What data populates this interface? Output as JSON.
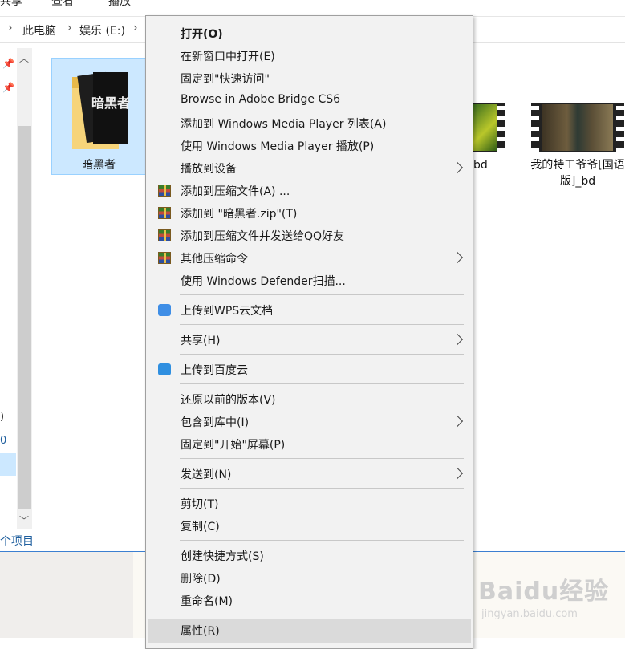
{
  "ribbon": {
    "tabs": [
      "共享",
      "查看",
      "播放"
    ]
  },
  "address_bar": {
    "crumbs": [
      "此电脑",
      "娱乐 (E:)"
    ]
  },
  "nav_pane": {
    "partial_labels": [
      ")",
      "0"
    ]
  },
  "status_bar": {
    "text": "个项目"
  },
  "files": [
    {
      "name": "暗黑者",
      "folder_art_text": "暗黑者",
      "selected": true
    },
    {
      "name": "bd",
      "partial": true
    },
    {
      "name": "我的特工爷爷[国语版]_bd"
    }
  ],
  "context_menu": {
    "items": [
      {
        "label": "打开(O)",
        "bold": true
      },
      {
        "label": "在新窗口中打开(E)"
      },
      {
        "label": "固定到\"快速访问\""
      },
      {
        "label": "Browse in Adobe Bridge CS6"
      },
      {
        "label": "添加到 Windows Media Player 列表(A)"
      },
      {
        "label": "使用 Windows Media Player 播放(P)"
      },
      {
        "label": "播放到设备",
        "submenu": true
      },
      {
        "label": "添加到压缩文件(A) ...",
        "icon": "winrar-icon"
      },
      {
        "label": "添加到 \"暗黑者.zip\"(T)",
        "icon": "winrar-icon"
      },
      {
        "label": "添加到压缩文件并发送给QQ好友",
        "icon": "winrar-icon"
      },
      {
        "label": "其他压缩命令",
        "icon": "winrar-icon",
        "submenu": true
      },
      {
        "label": "使用 Windows Defender扫描..."
      },
      {
        "label": "上传到WPS云文档",
        "icon": "wps-cloud-icon"
      },
      {
        "label": "共享(H)",
        "submenu": true
      },
      {
        "label": "上传到百度云",
        "icon": "baidu-cloud-icon"
      },
      {
        "label": "还原以前的版本(V)"
      },
      {
        "label": "包含到库中(I)",
        "submenu": true
      },
      {
        "label": "固定到\"开始\"屏幕(P)"
      },
      {
        "label": "发送到(N)",
        "submenu": true
      },
      {
        "label": "剪切(T)"
      },
      {
        "label": "复制(C)"
      },
      {
        "label": "创建快捷方式(S)"
      },
      {
        "label": "删除(D)"
      },
      {
        "label": "重命名(M)"
      },
      {
        "label": "属性(R)",
        "hovered": true
      }
    ]
  },
  "watermark": {
    "brand": "Baidu经验",
    "url": "jingyan.baidu.com"
  },
  "colors": {
    "menu_bg": "#f2f2f2",
    "selection": "#cce8ff",
    "hover": "#dadada",
    "accent_blue": "#3c7fd1"
  }
}
